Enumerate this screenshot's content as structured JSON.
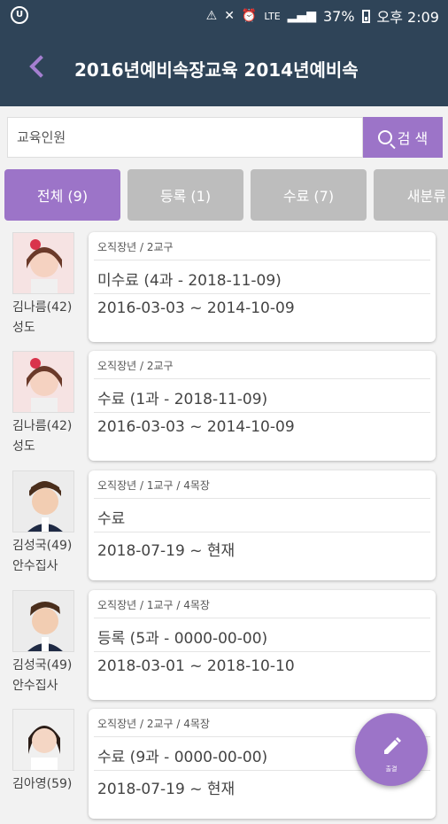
{
  "status_bar": {
    "battery": "37%",
    "time_label": "오후 2:09",
    "network": "LTE"
  },
  "header": {
    "title": "2016년예비속장교육 2014년예비속"
  },
  "search": {
    "placeholder": "교육인원",
    "button_label": "검 색"
  },
  "tabs": [
    {
      "label": "전체 (9)",
      "active": true
    },
    {
      "label": "등록 (1)",
      "active": false
    },
    {
      "label": "수료 (7)",
      "active": false
    },
    {
      "label": "새분류 (",
      "active": false
    }
  ],
  "list": [
    {
      "name": "김나름(42)",
      "role": "성도",
      "category": "오직장년 / 2교구",
      "status": "미수료 (4과 - 2018-11-09)",
      "dates": "2016-03-03 ~ 2014-10-09",
      "avatar": "female-avatar"
    },
    {
      "name": "김나름(42)",
      "role": "성도",
      "category": "오직장년 / 2교구",
      "status": "수료 (1과 - 2018-11-09)",
      "dates": "2016-03-03 ~ 2014-10-09",
      "avatar": "female-avatar"
    },
    {
      "name": "김성국(49)",
      "role": "안수집사",
      "category": "오직장년 / 1교구 / 4목장",
      "status": "수료",
      "dates": "2018-07-19 ~ 현재",
      "avatar": "male-avatar"
    },
    {
      "name": "김성국(49)",
      "role": "안수집사",
      "category": "오직장년 / 1교구 / 4목장",
      "status": "등록 (5과 - 0000-00-00)",
      "dates": "2018-03-01 ~ 2018-10-10",
      "avatar": "male-avatar"
    },
    {
      "name": "김아영(59)",
      "role": "",
      "category": "오직장년 / 2교구 / 4목장",
      "status": "수료 (9과 - 0000-00-00)",
      "dates": "2018-07-19 ~ 현재",
      "avatar": "female-avatar"
    }
  ],
  "fab": {
    "label": "출결",
    "icon": "pencil-icon"
  },
  "colors": {
    "appbar": "#2f4458",
    "accent": "#9c74c8",
    "tab_inactive": "#bdbdbd"
  }
}
